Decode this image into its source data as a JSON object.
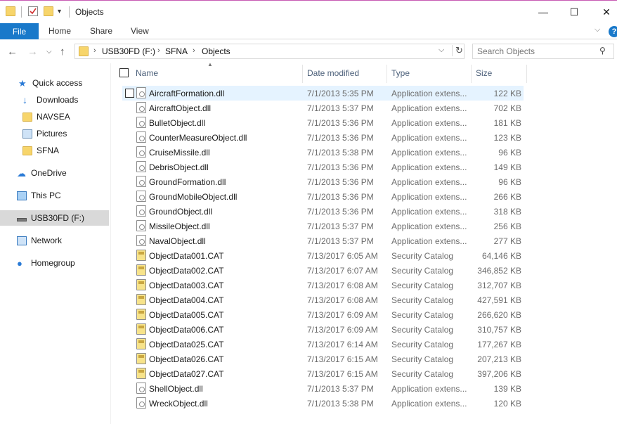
{
  "window": {
    "title": "Objects",
    "minimize": "—",
    "maximize": "☐",
    "close": "✕"
  },
  "ribbon": {
    "tabs": [
      "File",
      "Home",
      "Share",
      "View"
    ],
    "help": "?"
  },
  "address": {
    "crumbs": [
      "USB30FD (F:)",
      "SFNA",
      "Objects"
    ]
  },
  "search": {
    "placeholder": "Search Objects"
  },
  "sidebar": {
    "items": [
      {
        "label": "Quick access",
        "icon": "star-icon"
      },
      {
        "label": "Downloads",
        "icon": "download-arrow-icon"
      },
      {
        "label": "NAVSEA",
        "icon": "folder-icon"
      },
      {
        "label": "Pictures",
        "icon": "pictures-icon"
      },
      {
        "label": "SFNA",
        "icon": "folder-icon"
      },
      {
        "label": "OneDrive",
        "icon": "cloud-icon"
      },
      {
        "label": "This PC",
        "icon": "monitor-icon"
      },
      {
        "label": "USB30FD (F:)",
        "icon": "usb-drive-icon",
        "selected": true
      },
      {
        "label": "Network",
        "icon": "network-icon"
      },
      {
        "label": "Homegroup",
        "icon": "homegroup-icon"
      }
    ]
  },
  "columns": {
    "name": "Name",
    "date": "Date modified",
    "type": "Type",
    "size": "Size"
  },
  "files": [
    {
      "name": "AircraftFormation.dll",
      "date": "7/1/2013 5:35 PM",
      "type": "Application extens...",
      "size": "122 KB",
      "kind": "dll"
    },
    {
      "name": "AircraftObject.dll",
      "date": "7/1/2013 5:37 PM",
      "type": "Application extens...",
      "size": "702 KB",
      "kind": "dll"
    },
    {
      "name": "BulletObject.dll",
      "date": "7/1/2013 5:36 PM",
      "type": "Application extens...",
      "size": "181 KB",
      "kind": "dll"
    },
    {
      "name": "CounterMeasureObject.dll",
      "date": "7/1/2013 5:36 PM",
      "type": "Application extens...",
      "size": "123 KB",
      "kind": "dll"
    },
    {
      "name": "CruiseMissile.dll",
      "date": "7/1/2013 5:38 PM",
      "type": "Application extens...",
      "size": "96 KB",
      "kind": "dll"
    },
    {
      "name": "DebrisObject.dll",
      "date": "7/1/2013 5:36 PM",
      "type": "Application extens...",
      "size": "149 KB",
      "kind": "dll"
    },
    {
      "name": "GroundFormation.dll",
      "date": "7/1/2013 5:36 PM",
      "type": "Application extens...",
      "size": "96 KB",
      "kind": "dll"
    },
    {
      "name": "GroundMobileObject.dll",
      "date": "7/1/2013 5:36 PM",
      "type": "Application extens...",
      "size": "266 KB",
      "kind": "dll"
    },
    {
      "name": "GroundObject.dll",
      "date": "7/1/2013 5:36 PM",
      "type": "Application extens...",
      "size": "318 KB",
      "kind": "dll"
    },
    {
      "name": "MissileObject.dll",
      "date": "7/1/2013 5:37 PM",
      "type": "Application extens...",
      "size": "256 KB",
      "kind": "dll"
    },
    {
      "name": "NavalObject.dll",
      "date": "7/1/2013 5:37 PM",
      "type": "Application extens...",
      "size": "277 KB",
      "kind": "dll"
    },
    {
      "name": "ObjectData001.CAT",
      "date": "7/13/2017 6:05 AM",
      "type": "Security Catalog",
      "size": "64,146 KB",
      "kind": "cat"
    },
    {
      "name": "ObjectData002.CAT",
      "date": "7/13/2017 6:07 AM",
      "type": "Security Catalog",
      "size": "346,852 KB",
      "kind": "cat"
    },
    {
      "name": "ObjectData003.CAT",
      "date": "7/13/2017 6:08 AM",
      "type": "Security Catalog",
      "size": "312,707 KB",
      "kind": "cat"
    },
    {
      "name": "ObjectData004.CAT",
      "date": "7/13/2017 6:08 AM",
      "type": "Security Catalog",
      "size": "427,591 KB",
      "kind": "cat"
    },
    {
      "name": "ObjectData005.CAT",
      "date": "7/13/2017 6:09 AM",
      "type": "Security Catalog",
      "size": "266,620 KB",
      "kind": "cat"
    },
    {
      "name": "ObjectData006.CAT",
      "date": "7/13/2017 6:09 AM",
      "type": "Security Catalog",
      "size": "310,757 KB",
      "kind": "cat"
    },
    {
      "name": "ObjectData025.CAT",
      "date": "7/13/2017 6:14 AM",
      "type": "Security Catalog",
      "size": "177,267 KB",
      "kind": "cat"
    },
    {
      "name": "ObjectData026.CAT",
      "date": "7/13/2017 6:15 AM",
      "type": "Security Catalog",
      "size": "207,213 KB",
      "kind": "cat"
    },
    {
      "name": "ObjectData027.CAT",
      "date": "7/13/2017 6:15 AM",
      "type": "Security Catalog",
      "size": "397,206 KB",
      "kind": "cat"
    },
    {
      "name": "ShellObject.dll",
      "date": "7/1/2013 5:37 PM",
      "type": "Application extens...",
      "size": "139 KB",
      "kind": "dll"
    },
    {
      "name": "WreckObject.dll",
      "date": "7/1/2013 5:38 PM",
      "type": "Application extens...",
      "size": "120 KB",
      "kind": "dll"
    }
  ]
}
